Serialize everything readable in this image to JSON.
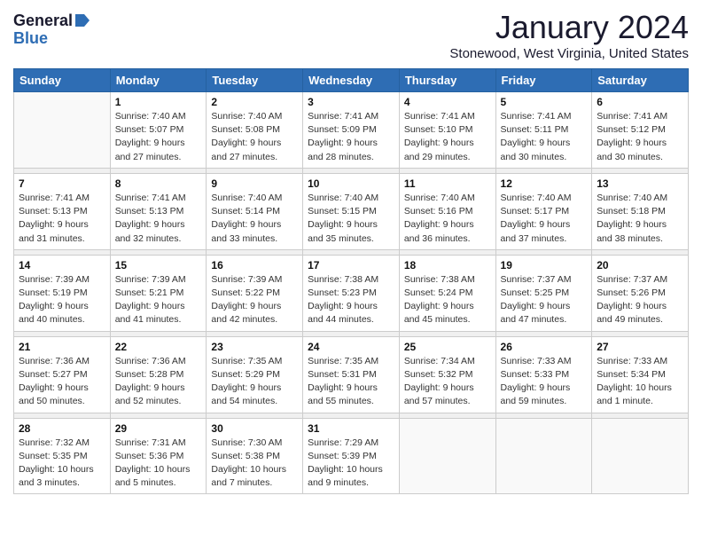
{
  "logo": {
    "general": "General",
    "blue": "Blue"
  },
  "title": "January 2024",
  "location": "Stonewood, West Virginia, United States",
  "weekdays": [
    "Sunday",
    "Monday",
    "Tuesday",
    "Wednesday",
    "Thursday",
    "Friday",
    "Saturday"
  ],
  "weeks": [
    [
      {
        "day": "",
        "sunrise": "",
        "sunset": "",
        "daylight": ""
      },
      {
        "day": "1",
        "sunrise": "Sunrise: 7:40 AM",
        "sunset": "Sunset: 5:07 PM",
        "daylight": "Daylight: 9 hours and 27 minutes."
      },
      {
        "day": "2",
        "sunrise": "Sunrise: 7:40 AM",
        "sunset": "Sunset: 5:08 PM",
        "daylight": "Daylight: 9 hours and 27 minutes."
      },
      {
        "day": "3",
        "sunrise": "Sunrise: 7:41 AM",
        "sunset": "Sunset: 5:09 PM",
        "daylight": "Daylight: 9 hours and 28 minutes."
      },
      {
        "day": "4",
        "sunrise": "Sunrise: 7:41 AM",
        "sunset": "Sunset: 5:10 PM",
        "daylight": "Daylight: 9 hours and 29 minutes."
      },
      {
        "day": "5",
        "sunrise": "Sunrise: 7:41 AM",
        "sunset": "Sunset: 5:11 PM",
        "daylight": "Daylight: 9 hours and 30 minutes."
      },
      {
        "day": "6",
        "sunrise": "Sunrise: 7:41 AM",
        "sunset": "Sunset: 5:12 PM",
        "daylight": "Daylight: 9 hours and 30 minutes."
      }
    ],
    [
      {
        "day": "7",
        "sunrise": "Sunrise: 7:41 AM",
        "sunset": "Sunset: 5:13 PM",
        "daylight": "Daylight: 9 hours and 31 minutes."
      },
      {
        "day": "8",
        "sunrise": "Sunrise: 7:41 AM",
        "sunset": "Sunset: 5:13 PM",
        "daylight": "Daylight: 9 hours and 32 minutes."
      },
      {
        "day": "9",
        "sunrise": "Sunrise: 7:40 AM",
        "sunset": "Sunset: 5:14 PM",
        "daylight": "Daylight: 9 hours and 33 minutes."
      },
      {
        "day": "10",
        "sunrise": "Sunrise: 7:40 AM",
        "sunset": "Sunset: 5:15 PM",
        "daylight": "Daylight: 9 hours and 35 minutes."
      },
      {
        "day": "11",
        "sunrise": "Sunrise: 7:40 AM",
        "sunset": "Sunset: 5:16 PM",
        "daylight": "Daylight: 9 hours and 36 minutes."
      },
      {
        "day": "12",
        "sunrise": "Sunrise: 7:40 AM",
        "sunset": "Sunset: 5:17 PM",
        "daylight": "Daylight: 9 hours and 37 minutes."
      },
      {
        "day": "13",
        "sunrise": "Sunrise: 7:40 AM",
        "sunset": "Sunset: 5:18 PM",
        "daylight": "Daylight: 9 hours and 38 minutes."
      }
    ],
    [
      {
        "day": "14",
        "sunrise": "Sunrise: 7:39 AM",
        "sunset": "Sunset: 5:19 PM",
        "daylight": "Daylight: 9 hours and 40 minutes."
      },
      {
        "day": "15",
        "sunrise": "Sunrise: 7:39 AM",
        "sunset": "Sunset: 5:21 PM",
        "daylight": "Daylight: 9 hours and 41 minutes."
      },
      {
        "day": "16",
        "sunrise": "Sunrise: 7:39 AM",
        "sunset": "Sunset: 5:22 PM",
        "daylight": "Daylight: 9 hours and 42 minutes."
      },
      {
        "day": "17",
        "sunrise": "Sunrise: 7:38 AM",
        "sunset": "Sunset: 5:23 PM",
        "daylight": "Daylight: 9 hours and 44 minutes."
      },
      {
        "day": "18",
        "sunrise": "Sunrise: 7:38 AM",
        "sunset": "Sunset: 5:24 PM",
        "daylight": "Daylight: 9 hours and 45 minutes."
      },
      {
        "day": "19",
        "sunrise": "Sunrise: 7:37 AM",
        "sunset": "Sunset: 5:25 PM",
        "daylight": "Daylight: 9 hours and 47 minutes."
      },
      {
        "day": "20",
        "sunrise": "Sunrise: 7:37 AM",
        "sunset": "Sunset: 5:26 PM",
        "daylight": "Daylight: 9 hours and 49 minutes."
      }
    ],
    [
      {
        "day": "21",
        "sunrise": "Sunrise: 7:36 AM",
        "sunset": "Sunset: 5:27 PM",
        "daylight": "Daylight: 9 hours and 50 minutes."
      },
      {
        "day": "22",
        "sunrise": "Sunrise: 7:36 AM",
        "sunset": "Sunset: 5:28 PM",
        "daylight": "Daylight: 9 hours and 52 minutes."
      },
      {
        "day": "23",
        "sunrise": "Sunrise: 7:35 AM",
        "sunset": "Sunset: 5:29 PM",
        "daylight": "Daylight: 9 hours and 54 minutes."
      },
      {
        "day": "24",
        "sunrise": "Sunrise: 7:35 AM",
        "sunset": "Sunset: 5:31 PM",
        "daylight": "Daylight: 9 hours and 55 minutes."
      },
      {
        "day": "25",
        "sunrise": "Sunrise: 7:34 AM",
        "sunset": "Sunset: 5:32 PM",
        "daylight": "Daylight: 9 hours and 57 minutes."
      },
      {
        "day": "26",
        "sunrise": "Sunrise: 7:33 AM",
        "sunset": "Sunset: 5:33 PM",
        "daylight": "Daylight: 9 hours and 59 minutes."
      },
      {
        "day": "27",
        "sunrise": "Sunrise: 7:33 AM",
        "sunset": "Sunset: 5:34 PM",
        "daylight": "Daylight: 10 hours and 1 minute."
      }
    ],
    [
      {
        "day": "28",
        "sunrise": "Sunrise: 7:32 AM",
        "sunset": "Sunset: 5:35 PM",
        "daylight": "Daylight: 10 hours and 3 minutes."
      },
      {
        "day": "29",
        "sunrise": "Sunrise: 7:31 AM",
        "sunset": "Sunset: 5:36 PM",
        "daylight": "Daylight: 10 hours and 5 minutes."
      },
      {
        "day": "30",
        "sunrise": "Sunrise: 7:30 AM",
        "sunset": "Sunset: 5:38 PM",
        "daylight": "Daylight: 10 hours and 7 minutes."
      },
      {
        "day": "31",
        "sunrise": "Sunrise: 7:29 AM",
        "sunset": "Sunset: 5:39 PM",
        "daylight": "Daylight: 10 hours and 9 minutes."
      },
      {
        "day": "",
        "sunrise": "",
        "sunset": "",
        "daylight": ""
      },
      {
        "day": "",
        "sunrise": "",
        "sunset": "",
        "daylight": ""
      },
      {
        "day": "",
        "sunrise": "",
        "sunset": "",
        "daylight": ""
      }
    ]
  ]
}
